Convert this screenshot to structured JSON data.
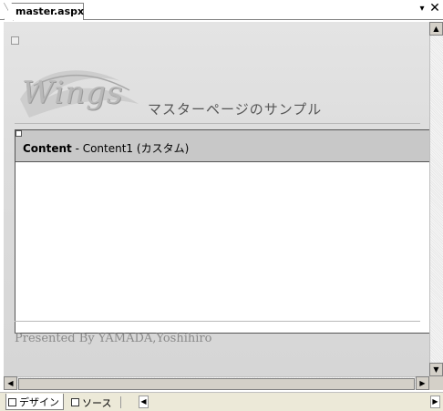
{
  "tab": {
    "title": "master.aspx",
    "dropdown_glyph": "▾",
    "close_glyph": "✕"
  },
  "design": {
    "logo_text": "Wings",
    "page_title": "マスターページのサンプル",
    "content_label_bold": "Content",
    "content_label_rest": " - Content1 (カスタム)",
    "footer_text": "Presented By YAMADA,Yoshihiro"
  },
  "scrollbars": {
    "up_arrow": "▲",
    "down_arrow": "▼",
    "left_arrow": "◀",
    "right_arrow": "▶"
  },
  "view_tabs": [
    {
      "label": "デザイン",
      "active": true
    },
    {
      "label": "ソース",
      "active": false
    }
  ],
  "colors": {
    "surface": "#dcdcdc",
    "content_header": "#c8c8c8",
    "footer_text": "#8a8a8a",
    "title_text": "#555555"
  },
  "icons": [
    "design-view-icon",
    "source-view-icon",
    "close-icon",
    "dropdown-icon"
  ]
}
